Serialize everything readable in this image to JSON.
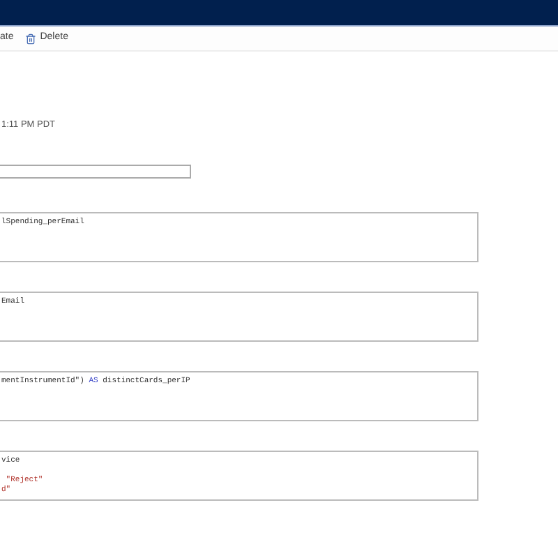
{
  "toolbar": {
    "items": [
      {
        "kind": "text",
        "label": "ate"
      },
      {
        "kind": "delete",
        "label": "Delete"
      }
    ]
  },
  "timestamp": "1:11 PM PDT",
  "field": {
    "kind": "text"
  },
  "code_boxes": [
    {
      "lines": [
        [
          {
            "text": "lSpending_perEmail",
            "kind": "plain"
          }
        ]
      ]
    },
    {
      "lines": [
        [
          {
            "text": "Email",
            "kind": "plain"
          }
        ]
      ]
    },
    {
      "lines": [
        [
          {
            "text": "mentInstrumentId\") ",
            "kind": "plain"
          },
          {
            "text": "AS",
            "kind": "keyword"
          },
          {
            "text": " distinctCards_perIP",
            "kind": "plain"
          }
        ]
      ]
    },
    {
      "lines": [
        [
          {
            "text": "vice",
            "kind": "plain"
          }
        ],
        [
          {
            "kind": "blank"
          }
        ],
        [
          {
            "text": " \"Reject\"",
            "kind": "string"
          }
        ],
        [
          {
            "text": "d\"",
            "kind": "string"
          }
        ]
      ]
    }
  ]
}
